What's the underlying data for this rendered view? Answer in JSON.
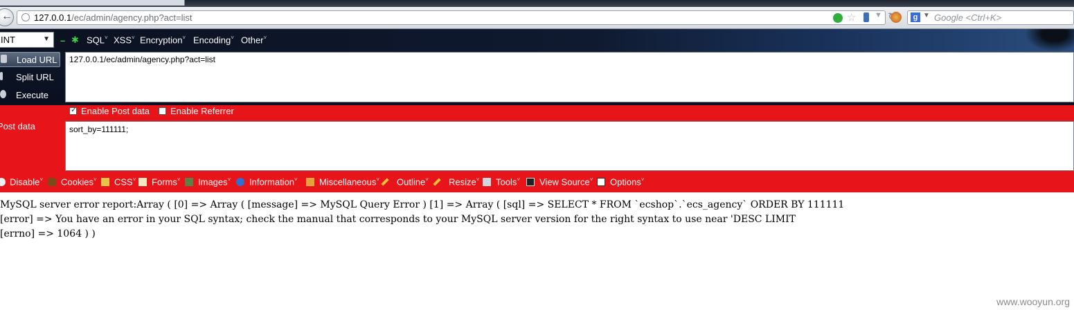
{
  "browser": {
    "url_host": "127.0.0.1",
    "url_path": "/ec/admin/agency.php?act=list",
    "search_placeholder": "Google <Ctrl+K>"
  },
  "hackbar": {
    "mode_select": "INT",
    "menus": [
      "SQL",
      "XSS",
      "Encryption",
      "Encoding",
      "Other"
    ],
    "buttons": {
      "load_url": "Load URL",
      "split_url": "Split URL",
      "execute": "Execute"
    },
    "url_value": "127.0.0.1/ec/admin/agency.php?act=list",
    "enable_post": {
      "label": "Enable Post data",
      "checked": true
    },
    "enable_referrer": {
      "label": "Enable Referrer",
      "checked": false
    },
    "post_label": "Post data",
    "post_value": "sort_by=111111;"
  },
  "webdev_toolbar": {
    "items": [
      "Disable",
      "Cookies",
      "CSS",
      "Forms",
      "Images",
      "Information",
      "Miscellaneous",
      "Outline",
      "Resize",
      "Tools",
      "View Source",
      "Options"
    ]
  },
  "output": {
    "line1": "MySQL server error report:Array ( [0] => Array ( [message] => MySQL Query Error ) [1] => Array ( [sql] => SELECT * FROM `ecshop`.`ecs_agency` ORDER BY 111111",
    "line2": "[error] => You have an error in your SQL syntax; check the manual that corresponds to your MySQL server version for the right syntax to use near 'DESC LIMIT",
    "line3": "[errno] => 1064 ) )"
  },
  "watermark": "www.wooyun.org"
}
